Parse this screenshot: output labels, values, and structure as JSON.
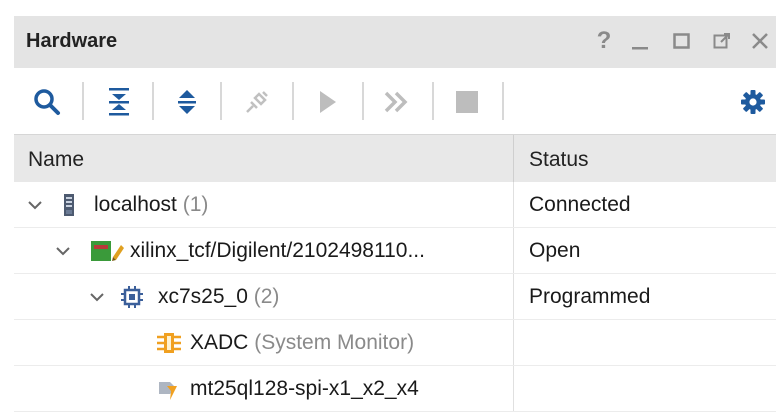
{
  "panel": {
    "title": "Hardware",
    "window_controls": [
      "help-icon",
      "minimize-icon",
      "maximize-icon",
      "float-icon",
      "close-icon"
    ]
  },
  "toolbar": {
    "buttons": [
      "search-icon",
      "collapse-all-icon",
      "expand-all-icon",
      "auto-connect-icon",
      "run-icon",
      "run-all-icon",
      "stop-icon"
    ],
    "settings_icon": "gear-icon",
    "accent_color": "#1e5a9e"
  },
  "table": {
    "columns": [
      "Name",
      "Status"
    ],
    "rows": [
      {
        "label": "localhost",
        "count": "(1)",
        "status": "Connected",
        "icon": "server-icon"
      },
      {
        "label": "xilinx_tcf/Digilent/2102498110...",
        "count": "",
        "status": "Open",
        "icon": "jtag-cable-icon"
      },
      {
        "label": "xc7s25_0",
        "count": "(2)",
        "status": "Programmed",
        "icon": "chip-icon"
      },
      {
        "label": "XADC",
        "count": "(System Monitor)",
        "status": "",
        "icon": "xadc-icon"
      },
      {
        "label": "mt25ql128-spi-x1_x2_x4",
        "count": "",
        "status": "",
        "icon": "flash-memory-icon"
      }
    ]
  }
}
